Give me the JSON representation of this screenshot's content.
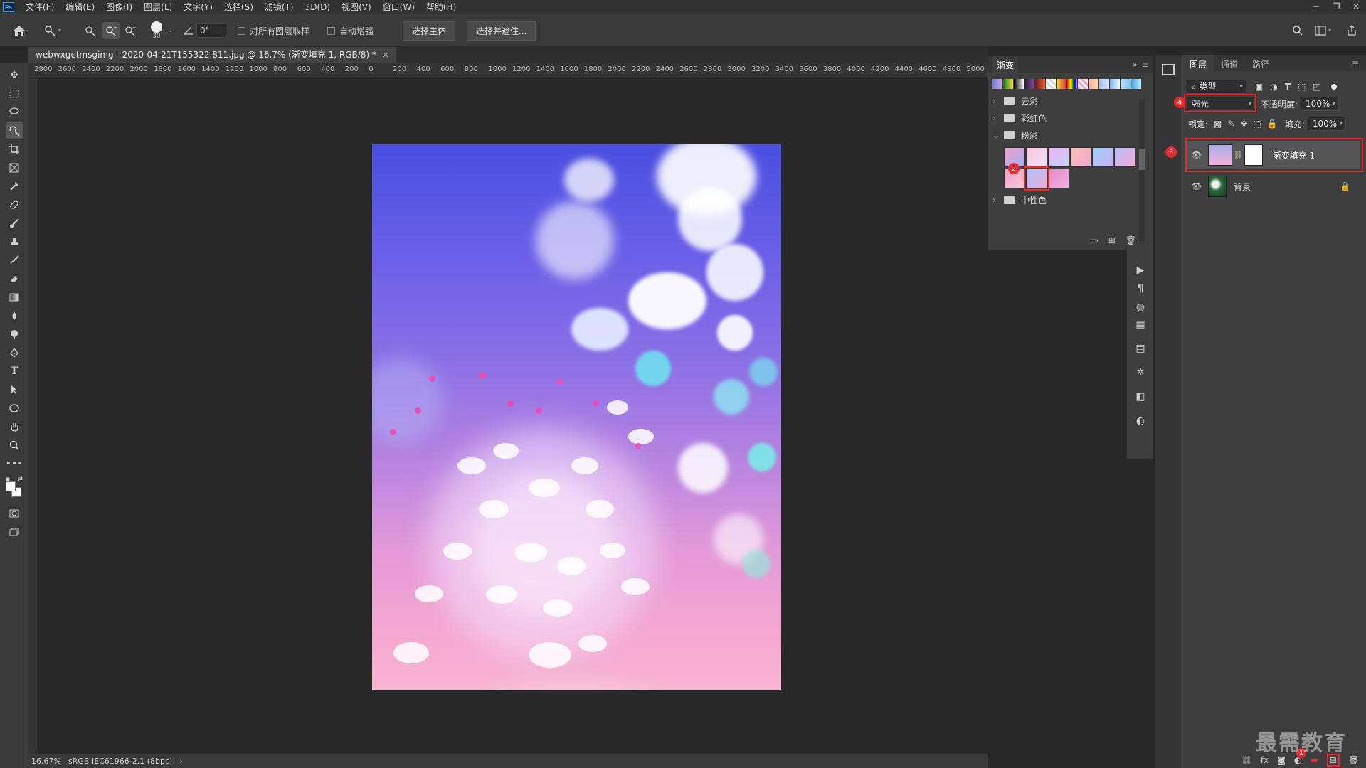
{
  "menubar": {
    "logo": "Ps",
    "items": [
      "文件(F)",
      "编辑(E)",
      "图像(I)",
      "图层(L)",
      "文字(Y)",
      "选择(S)",
      "滤镜(T)",
      "3D(D)",
      "视图(V)",
      "窗口(W)",
      "帮助(H)"
    ],
    "window_controls": [
      "−",
      "❐",
      "✕"
    ]
  },
  "options": {
    "brush_size": "30",
    "angle": "0°",
    "sample_all_layers": "对所有图层取样",
    "auto_enhance": "自动增强",
    "select_subject": "选择主体",
    "select_and_mask": "选择并遮住..."
  },
  "document": {
    "tab_title": "webwxgetmsgimg - 2020-04-21T155322.811.jpg @ 16.7% (渐变填充 1, RGB/8) *",
    "close": "×",
    "ruler_ticks": [
      "2800",
      "2600",
      "2400",
      "2200",
      "2000",
      "1800",
      "1600",
      "1400",
      "1200",
      "1000",
      "800",
      "600",
      "400",
      "200",
      "0",
      "200",
      "400",
      "600",
      "800",
      "1000",
      "1200",
      "1400",
      "1600",
      "1800",
      "2000",
      "2200",
      "2400",
      "2600",
      "2800",
      "3000",
      "3200",
      "3400",
      "3600",
      "3800",
      "4000",
      "4200",
      "4400",
      "4600",
      "4800",
      "5000"
    ]
  },
  "status": {
    "zoom": "16.67%",
    "profile": "sRGB IEC61966-2.1 (8bpc)",
    "arrow": "›"
  },
  "gradient_panel": {
    "title": "渐变",
    "folders": [
      {
        "name": "云彩",
        "arrow": "›"
      },
      {
        "name": "彩虹色",
        "arrow": "›"
      },
      {
        "name": "粉彩",
        "arrow": "⌄"
      },
      {
        "name": "中性色",
        "arrow": "›"
      }
    ],
    "badge_2": "2"
  },
  "layers_panel": {
    "tabs": [
      "图层",
      "通道",
      "路径"
    ],
    "filter_type": "类型",
    "blend_mode": "强光",
    "opacity_label": "不透明度:",
    "opacity_value": "100%",
    "lock_label": "锁定:",
    "fill_label": "填充:",
    "fill_value": "100%",
    "badge_3": "3",
    "badge_4": "4",
    "badge_1": "1",
    "layers": [
      {
        "name": "渐变填充 1"
      },
      {
        "name": "背景"
      }
    ],
    "bottom_icons": [
      "fx"
    ]
  },
  "watermark": "最需教育",
  "colors": {
    "accent": "#31a8ff",
    "highlight_red": "#e8282b",
    "panel": "#3e3e3e"
  }
}
